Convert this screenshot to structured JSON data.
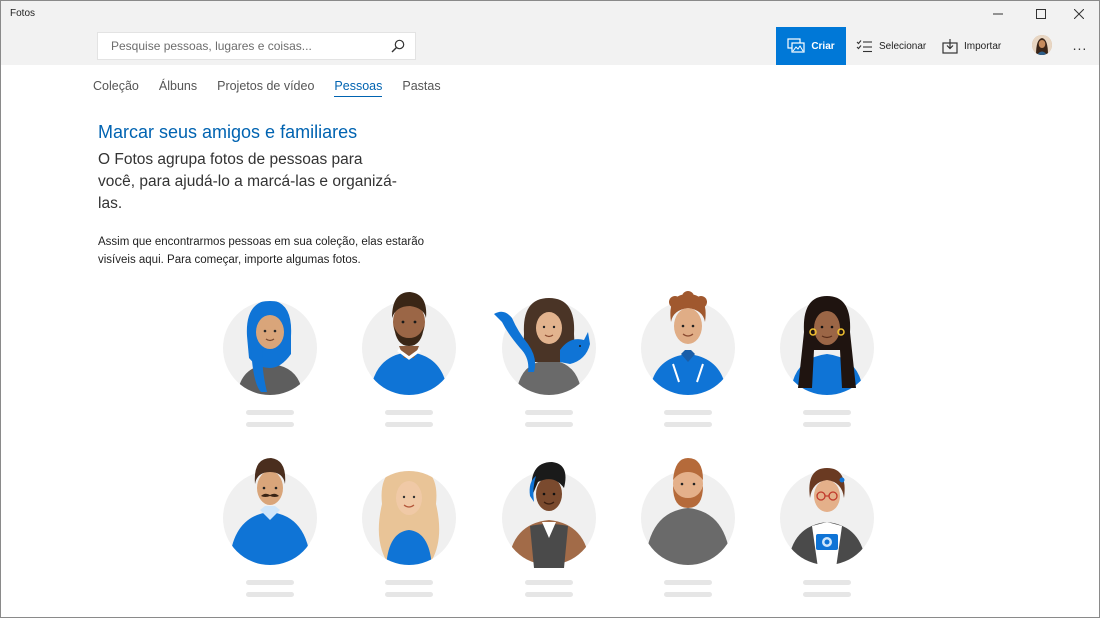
{
  "window": {
    "title": "Fotos"
  },
  "search": {
    "placeholder": "Pesquise pessoas, lugares e coisas..."
  },
  "commands": {
    "create_label": "Criar",
    "select_label": "Selecionar",
    "import_label": "Importar",
    "more_label": "..."
  },
  "tabs": [
    {
      "label": "Coleção"
    },
    {
      "label": "Álbuns"
    },
    {
      "label": "Projetos de vídeo"
    },
    {
      "label": "Pessoas",
      "active": true
    },
    {
      "label": "Pastas"
    }
  ],
  "content": {
    "heading": "Marcar seus amigos e familiares",
    "subheading": "O Fotos agrupa fotos de pessoas para você, para ajudá-lo a marcá-las e organizá-las.",
    "body": "Assim que encontrarmos pessoas em sua coleção, elas estarão visíveis aqui. Para começar, importe algumas fotos."
  },
  "colors": {
    "accent": "#0078d7",
    "accent_text": "#0063b1",
    "header_bg": "#f2f2f2",
    "placeholder_bar": "#e6e6e6"
  },
  "icons": {
    "create": "create-slideshow-icon",
    "select": "checklist-icon",
    "import": "import-icon",
    "search": "search-icon",
    "minimize": "minimize-icon",
    "maximize": "maximize-icon",
    "close": "close-icon"
  },
  "people": [
    {
      "name": "person-blue-hijab"
    },
    {
      "name": "person-bearded-man"
    },
    {
      "name": "person-woman-with-cat"
    },
    {
      "name": "person-curly-hair-man"
    },
    {
      "name": "person-long-hair-woman"
    },
    {
      "name": "person-mustache-man"
    },
    {
      "name": "person-blonde-woman"
    },
    {
      "name": "person-vest-man"
    },
    {
      "name": "person-bald-beard-man"
    },
    {
      "name": "person-glasses-woman-camera"
    }
  ]
}
